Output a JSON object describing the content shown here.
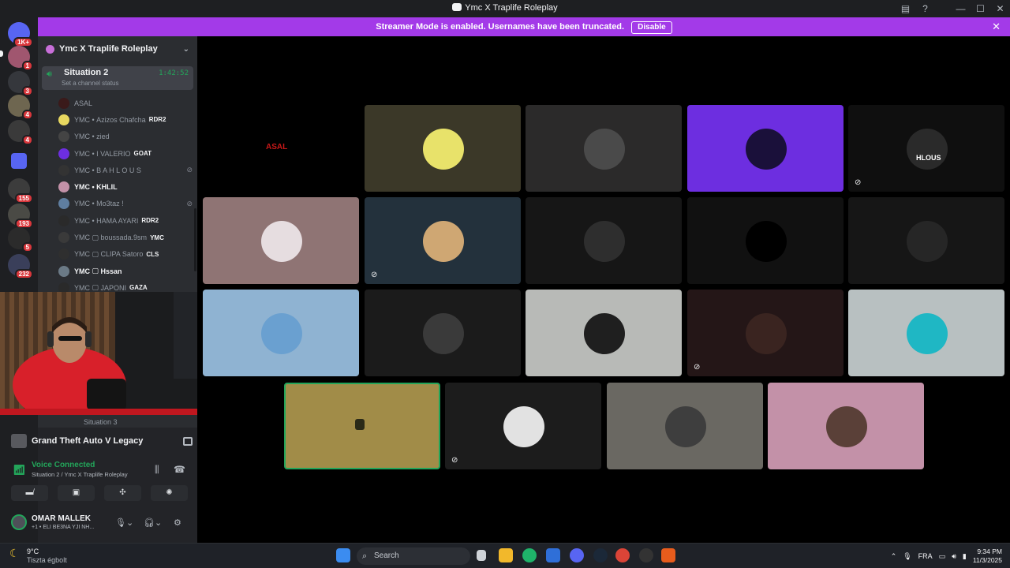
{
  "window": {
    "title": "Ymc X Traplife Roleplay"
  },
  "banner": {
    "text": "Streamer Mode is enabled. Usernames have been truncated.",
    "button": "Disable"
  },
  "servers": [
    {
      "badge": "1K+"
    },
    {
      "badge": "1"
    },
    {
      "badge": "3"
    },
    {
      "badge": "4"
    },
    {
      "badge": "4"
    },
    {
      "badge": ""
    },
    {
      "badge": "155"
    },
    {
      "badge": "193"
    },
    {
      "badge": "5"
    },
    {
      "badge": "232"
    }
  ],
  "guild": {
    "name": "Ymc X Traplife Roleplay"
  },
  "voice_channel": {
    "name": "Situation 2",
    "status": "Set a channel status",
    "timer": "1:42:52",
    "next_channel": "Situation 3"
  },
  "members": [
    {
      "prefix": "",
      "name": "ASAL",
      "tag": ""
    },
    {
      "prefix": "YMC",
      "name": "Azizos Chafcha",
      "tag": "RDR2"
    },
    {
      "prefix": "YMC",
      "name": "zied",
      "tag": ""
    },
    {
      "prefix": "YMC",
      "name": "I VALERIO",
      "tag": "GOAT"
    },
    {
      "prefix": "YMC",
      "name": "B A H L O U S",
      "tag": ""
    },
    {
      "prefix": "YMC",
      "name": "KHLIL",
      "tag": ""
    },
    {
      "prefix": "YMC",
      "name": "Mo3taz !",
      "tag": ""
    },
    {
      "prefix": "YMC",
      "name": "HAMA AYARI",
      "tag": "RDR2"
    },
    {
      "prefix": "YMC",
      "name": "boussada.9sm",
      "tag": "YMC"
    },
    {
      "prefix": "YMC",
      "name": "CLIPA Satoro",
      "tag": "CLS"
    },
    {
      "prefix": "YMC",
      "name": "Hssan",
      "tag": ""
    },
    {
      "prefix": "YMC",
      "name": "JAPONI",
      "tag": "GAZA"
    }
  ],
  "activity": {
    "game": "Grand Theft Auto V Legacy"
  },
  "voice_status": {
    "title": "Voice Connected",
    "subtitle": "Situation 2 / Ymc X Traplife Roleplay"
  },
  "user": {
    "name": "OMAR MALLEK",
    "status": "+1 • ELI BE3NA YJI NH..."
  },
  "tiles": [
    {
      "label": "ASAL",
      "color": "#000000"
    },
    {
      "label": "",
      "color": "#3b3828"
    },
    {
      "label": "",
      "color": "#2b2a2a"
    },
    {
      "label": "",
      "color": "#6d2ee0"
    },
    {
      "label": "HLOUS",
      "color": "#0f0f0f"
    },
    {
      "label": "",
      "color": "#8f7474"
    },
    {
      "label": "",
      "color": "#23313c"
    },
    {
      "label": "",
      "color": "#161616"
    },
    {
      "label": "",
      "color": "#111111"
    },
    {
      "label": "",
      "color": "#161616"
    },
    {
      "label": "",
      "color": "#8fb3d2"
    },
    {
      "label": "",
      "color": "#1b1b1b"
    },
    {
      "label": "",
      "color": "#b8bab7"
    },
    {
      "label": "",
      "color": "#241617"
    },
    {
      "label": "",
      "color": "#b8c0c1"
    },
    {
      "label": "",
      "color": "#a18c48"
    },
    {
      "label": "",
      "color": "#1c1c1c"
    },
    {
      "label": "",
      "color": "#6a6862"
    },
    {
      "label": "",
      "color": "#c391a8"
    }
  ],
  "taskbar": {
    "weather_temp": "9°C",
    "weather_text": "Tiszta égbolt",
    "search_placeholder": "Search",
    "lang": "FRA",
    "time": "9:34 PM",
    "date": "11/3/2025"
  }
}
